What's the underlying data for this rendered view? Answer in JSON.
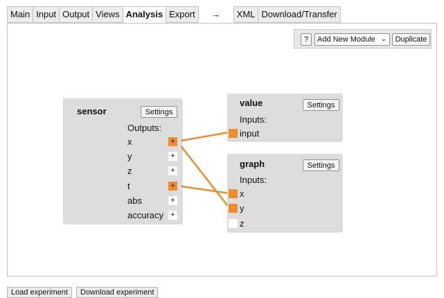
{
  "tabs": {
    "main": "Main",
    "input": "Input",
    "output": "Output",
    "views": "Views",
    "analysis": "Analysis",
    "export": "Export",
    "arrow": "→",
    "xml": "XML",
    "download_transfer": "Download/Transfer"
  },
  "toolbar": {
    "help": "?",
    "add_module": "Add New Module",
    "duplicate": "Duplicate"
  },
  "modules": {
    "sensor": {
      "title": "sensor",
      "settings": "Settings",
      "outputs_label": "Outputs:",
      "outputs": [
        "x",
        "y",
        "z",
        "t",
        "abs",
        "accuracy"
      ],
      "port_symbol": "+"
    },
    "value": {
      "title": "value",
      "settings": "Settings",
      "inputs_label": "Inputs:",
      "inputs": [
        "input"
      ]
    },
    "graph": {
      "title": "graph",
      "settings": "Settings",
      "inputs_label": "Inputs:",
      "inputs": [
        "x",
        "y",
        "z"
      ]
    }
  },
  "footer": {
    "load": "Load experiment",
    "download": "Download experiment"
  },
  "colors": {
    "wire": "#f08c2a",
    "module_bg": "#dddddd"
  }
}
